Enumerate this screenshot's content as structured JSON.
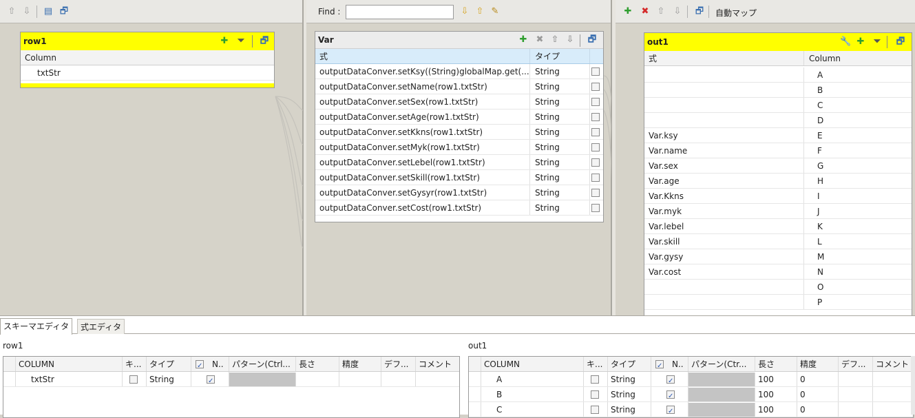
{
  "left_panel": {
    "table": {
      "title": "row1",
      "column_header": "Column",
      "rows": [
        "txtStr"
      ]
    }
  },
  "var_panel": {
    "find_label": "Find :",
    "table": {
      "title": "Var",
      "header_expr": "式",
      "header_type": "タイプ",
      "rows": [
        {
          "expr": "outputDataConver.setKsy((String)globalMap.get(...",
          "type": "String"
        },
        {
          "expr": "outputDataConver.setName(row1.txtStr)",
          "type": "String"
        },
        {
          "expr": "outputDataConver.setSex(row1.txtStr)",
          "type": "String"
        },
        {
          "expr": "outputDataConver.setAge(row1.txtStr)",
          "type": "String"
        },
        {
          "expr": "outputDataConver.setKkns(row1.txtStr)",
          "type": "String"
        },
        {
          "expr": "outputDataConver.setMyk(row1.txtStr)",
          "type": "String"
        },
        {
          "expr": "outputDataConver.setLebel(row1.txtStr)",
          "type": "String"
        },
        {
          "expr": "outputDataConver.setSkill(row1.txtStr)",
          "type": "String"
        },
        {
          "expr": "outputDataConver.setGysyr(row1.txtStr)",
          "type": "String"
        },
        {
          "expr": "outputDataConver.setCost(row1.txtStr)",
          "type": "String"
        }
      ]
    }
  },
  "out_panel": {
    "auto_map_label": "自動マップ",
    "table": {
      "title": "out1",
      "header_expr": "式",
      "header_column": "Column",
      "rows": [
        {
          "expr": "",
          "column": "A"
        },
        {
          "expr": "",
          "column": "B"
        },
        {
          "expr": "",
          "column": "C"
        },
        {
          "expr": "",
          "column": "D"
        },
        {
          "expr": "Var.ksy",
          "column": "E"
        },
        {
          "expr": "Var.name",
          "column": "F"
        },
        {
          "expr": "Var.sex",
          "column": "G"
        },
        {
          "expr": "Var.age",
          "column": "H"
        },
        {
          "expr": "Var.Kkns",
          "column": "I"
        },
        {
          "expr": "Var.myk",
          "column": "J"
        },
        {
          "expr": "Var.lebel",
          "column": "K"
        },
        {
          "expr": "Var.skill",
          "column": "L"
        },
        {
          "expr": "Var.gysy",
          "column": "M"
        },
        {
          "expr": "Var.cost",
          "column": "N"
        },
        {
          "expr": "",
          "column": "O"
        },
        {
          "expr": "",
          "column": "P"
        }
      ]
    }
  },
  "bottom": {
    "tabs": [
      "スキーマエディタ",
      "式エディタ"
    ],
    "left": {
      "title": "row1",
      "headers": [
        "COLUMN",
        "キ...",
        "タイプ",
        "N..",
        "パターン(Ctrl...",
        "長さ",
        "精度",
        "デフ...",
        "コメント"
      ],
      "rows": [
        {
          "column": "txtStr",
          "type": "String",
          "key": false,
          "nullable": true,
          "length": "",
          "precision": ""
        }
      ]
    },
    "right": {
      "title": "out1",
      "headers": [
        "COLUMN",
        "キ...",
        "タイプ",
        "N..",
        "パターン(Ctr...",
        "長さ",
        "精度",
        "デフ...",
        "コメント"
      ],
      "rows": [
        {
          "column": "A",
          "type": "String",
          "key": false,
          "nullable": true,
          "length": "100",
          "precision": "0"
        },
        {
          "column": "B",
          "type": "String",
          "key": false,
          "nullable": true,
          "length": "100",
          "precision": "0"
        },
        {
          "column": "C",
          "type": "String",
          "key": false,
          "nullable": true,
          "length": "100",
          "precision": "0"
        }
      ]
    }
  },
  "colors": {
    "header_yellow": "#ffff00",
    "selected_header": "#cfe8f8",
    "add_green": "#2f9e2f",
    "delete_red": "#d42a2a"
  }
}
